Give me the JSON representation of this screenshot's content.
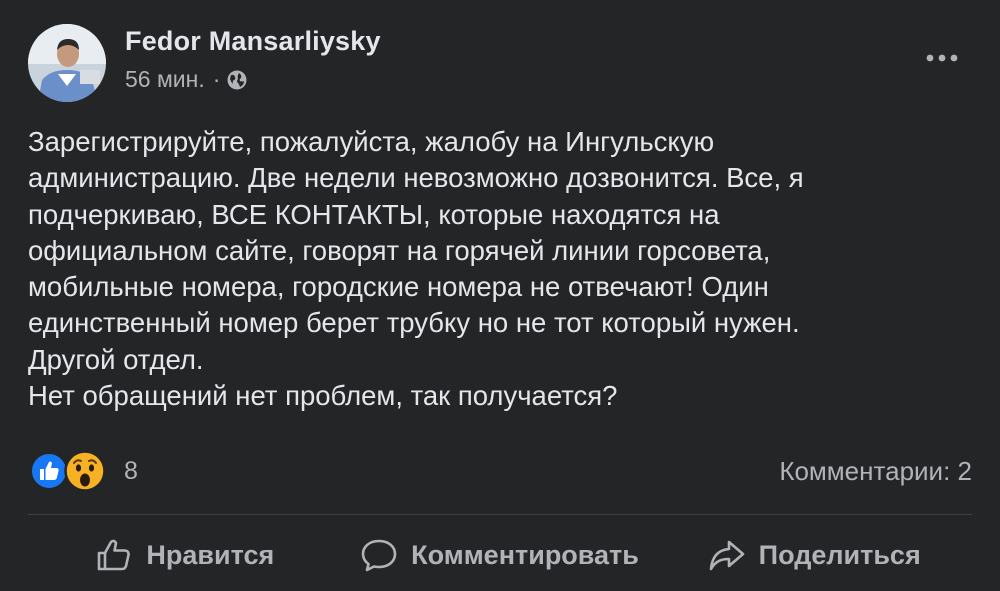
{
  "post": {
    "author": "Fedor Mansarliysky",
    "time": "56 мин.",
    "separator": "·",
    "audience_icon": "globe-icon",
    "more_icon": "more-horizontal-icon",
    "body_lines": [
      "Зарегистрируйте, пожалуйста, жалобу на Ингульскую",
      "администрацию. Две недели невозможно дозвонится. Все, я",
      "подчеркиваю, ВСЕ КОНТАКТЫ, которые находятся на",
      "официальном сайте, говорят на горячей линии горсовета,",
      "мобильные номера, городские номера не отвечают! Один",
      "единственный номер берет трубку но не тот который нужен.",
      "Другой отдел.",
      "Нет обращений нет проблем, так получается?"
    ]
  },
  "reactions": {
    "icons": [
      "like-reaction-icon",
      "wow-reaction-icon"
    ],
    "count": "8",
    "comments_label": "Комментарии: 2"
  },
  "actions": {
    "like_label": "Нравится",
    "comment_label": "Комментировать",
    "share_label": "Поделиться"
  },
  "colors": {
    "background": "#242526",
    "text_primary": "#e4e6eb",
    "text_secondary": "#b0b3b8",
    "like_blue": "#1877f2",
    "wow_yellow": "#f7b125"
  }
}
